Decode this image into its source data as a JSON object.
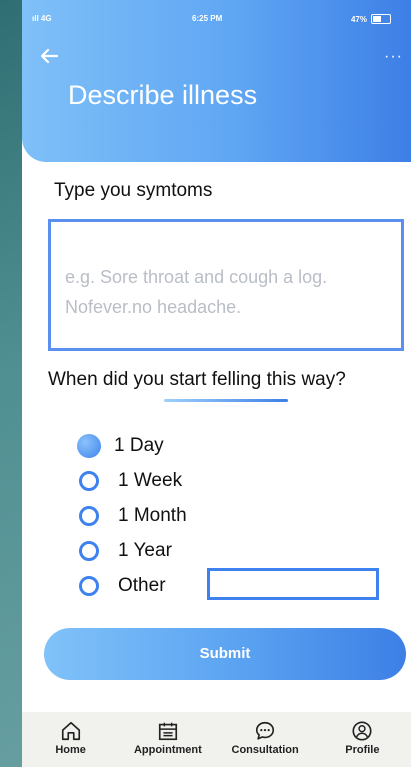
{
  "status": {
    "signal": "ıll 4G",
    "time": "6:25 PM",
    "battery": "47%"
  },
  "header": {
    "title": "Describe illness",
    "more": "···"
  },
  "symptoms": {
    "label": "Type you symtoms",
    "placeholder": "e.g. Sore throat and cough a log. Nofever.no headache."
  },
  "duration": {
    "question": "When did you start felling this way?",
    "options": [
      {
        "label": "1 Day",
        "selected": true
      },
      {
        "label": "1 Week",
        "selected": false
      },
      {
        "label": "1 Month",
        "selected": false
      },
      {
        "label": "1 Year",
        "selected": false
      },
      {
        "label": "Other",
        "selected": false
      }
    ],
    "other_value": ""
  },
  "submit_label": "Submit",
  "nav": {
    "items": [
      {
        "label": "Home",
        "icon": "home-icon"
      },
      {
        "label": "Appointment",
        "icon": "calendar-icon"
      },
      {
        "label": "Consultation",
        "icon": "chat-icon"
      },
      {
        "label": "Profile",
        "icon": "profile-icon"
      }
    ]
  },
  "colors": {
    "accent": "#3d82ee",
    "accent_light": "#80c2f9",
    "nav_bg": "#f1f2ee"
  }
}
